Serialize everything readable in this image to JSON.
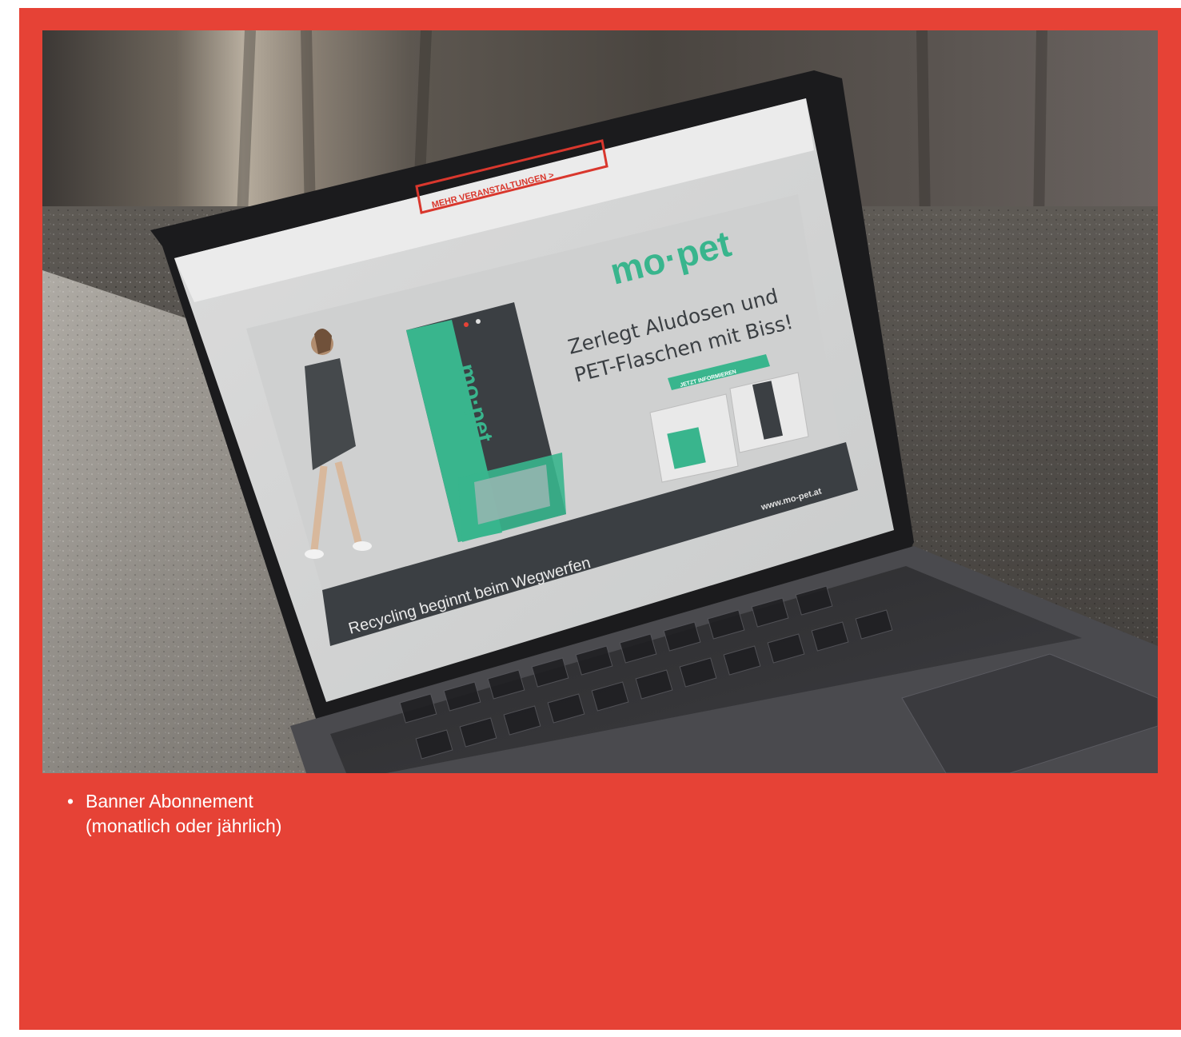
{
  "colors": {
    "background": "#e64236",
    "caption_text": "#ffffff",
    "brand_green": "#39b58d",
    "banner_dark": "#3b3f43"
  },
  "photo": {
    "description_icon": "laptop-photo",
    "screen": {
      "top_button_label": "MEHR VERANSTALTUNGEN >",
      "brand_logo": "mo·pet",
      "headline_line1": "Zerlegt Aludosen und",
      "headline_line2": "PET-Flaschen mit Biss!",
      "cta_label": "JETZT INFORMIEREN",
      "machine_label": "mo·pet",
      "website": "www.mo-pet.at",
      "footer_slogan": "Recycling beginnt beim Wegwerfen"
    }
  },
  "caption": {
    "bullet": "•",
    "line1": "Banner Abonnement",
    "line2": "(monatlich oder jährlich)"
  }
}
